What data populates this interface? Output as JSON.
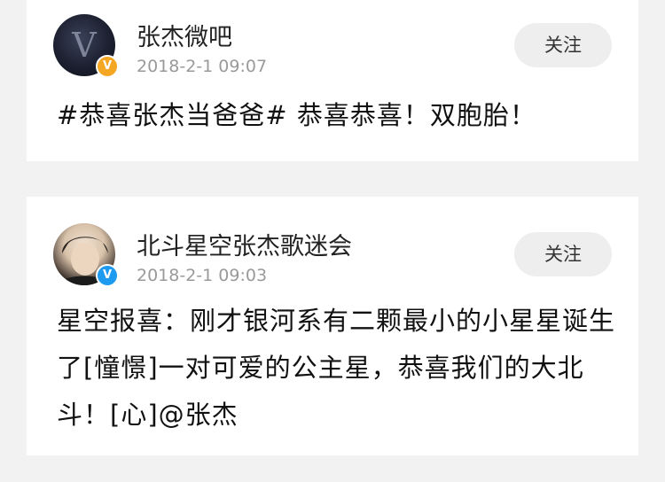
{
  "posts": [
    {
      "author": "张杰微吧",
      "timestamp": "2018-2-1 09:07",
      "follow_label": "关注",
      "text": "#恭喜张杰当爸爸# 恭喜恭喜！双胞胎！",
      "verified_color": "#f5a623",
      "avatar_icon": "v-logo-avatar"
    },
    {
      "author": "北斗星空张杰歌迷会",
      "timestamp": "2018-2-1 09:03",
      "follow_label": "关注",
      "text": "星空报喜：刚才银河系有二颗最小的小星星诞生了[憧憬]一对可爱的公主星，恭喜我们的大北斗！[心]@张杰",
      "verified_color": "#1e9bf0",
      "avatar_icon": "user-photo-avatar"
    }
  ],
  "verified_badge_glyph": "V"
}
